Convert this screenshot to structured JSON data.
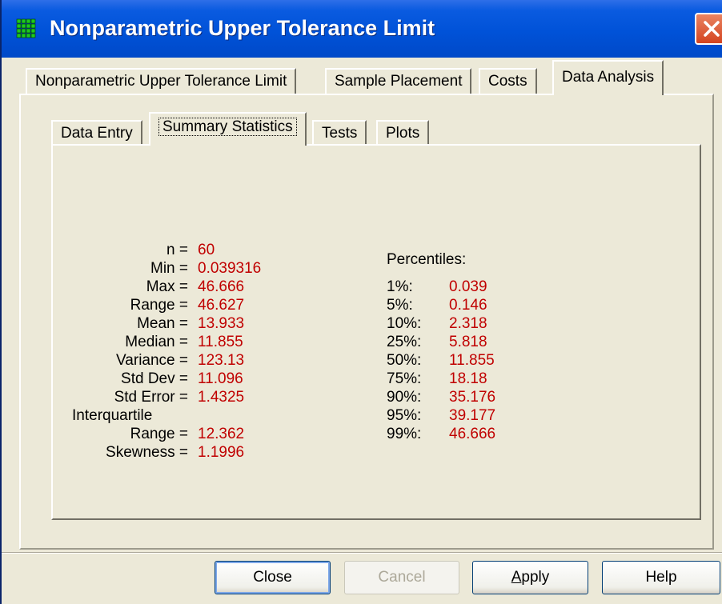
{
  "window": {
    "title": "Nonparametric Upper Tolerance Limit",
    "icons": {
      "app": "grid-app-icon",
      "close": "close-icon"
    }
  },
  "tabs": [
    {
      "label": "Nonparametric Upper Tolerance Limit",
      "active": false
    },
    {
      "label": "Sample Placement",
      "active": false
    },
    {
      "label": "Costs",
      "active": false
    },
    {
      "label": "Data Analysis",
      "active": true
    }
  ],
  "subtabs": [
    {
      "label": "Data Entry",
      "active": false
    },
    {
      "label": "Summary Statistics",
      "active": true
    },
    {
      "label": "Tests",
      "active": false
    },
    {
      "label": "Plots",
      "active": false
    }
  ],
  "stats": [
    {
      "label": "n =",
      "value": "60"
    },
    {
      "label": "Min =",
      "value": "0.039316"
    },
    {
      "label": "Max =",
      "value": "46.666"
    },
    {
      "label": "Range =",
      "value": "46.627"
    },
    {
      "label": "Mean =",
      "value": "13.933"
    },
    {
      "label": "Median =",
      "value": "11.855"
    },
    {
      "label": "Variance =",
      "value": "123.13"
    },
    {
      "label": "Std Dev =",
      "value": "11.096"
    },
    {
      "label": "Std Error =",
      "value": "1.4325"
    },
    {
      "label": "Interquartile",
      "value": ""
    },
    {
      "label": "Range =",
      "value": "12.362"
    },
    {
      "label": "Skewness =",
      "value": "1.1996"
    }
  ],
  "percentiles": {
    "title": "Percentiles:",
    "rows": [
      {
        "label": "1%:",
        "value": "0.039"
      },
      {
        "label": "5%:",
        "value": "0.146"
      },
      {
        "label": "10%:",
        "value": "2.318"
      },
      {
        "label": "25%:",
        "value": "5.818"
      },
      {
        "label": "50%:",
        "value": "11.855"
      },
      {
        "label": "75%:",
        "value": "18.18"
      },
      {
        "label": "90%:",
        "value": "35.176"
      },
      {
        "label": "95%:",
        "value": "39.177"
      },
      {
        "label": "99%:",
        "value": "46.666"
      }
    ]
  },
  "buttons": {
    "close": "Close",
    "cancel": "Cancel",
    "apply_accel": "A",
    "apply_rest": "pply",
    "help": "Help"
  },
  "colors": {
    "value_text": "#C00000",
    "title_bar": "#0052D8"
  }
}
